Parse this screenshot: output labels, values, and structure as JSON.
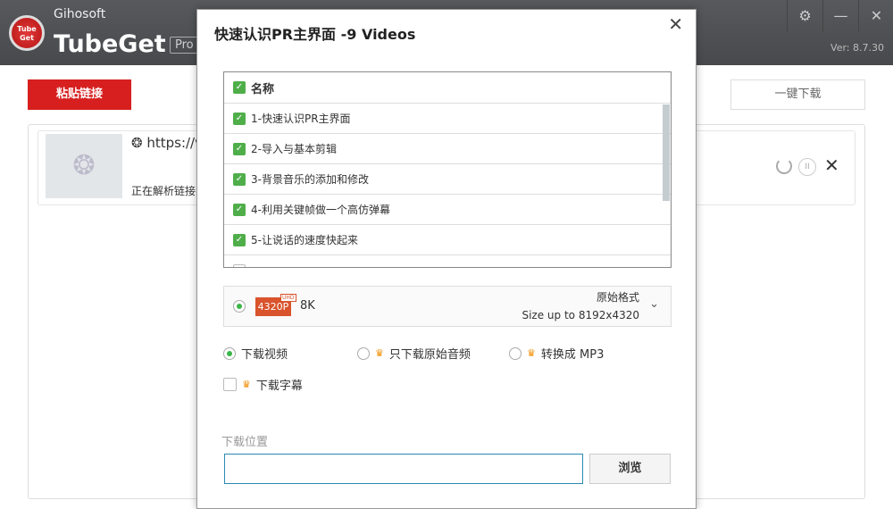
{
  "app": {
    "vendor": "Gihosoft",
    "name": "TubeGet",
    "edition": "Pro",
    "version": "Ver: 8.7.30",
    "logo_text": "Tube Get"
  },
  "toolbar": {
    "paste_label": "粘贴链接",
    "one_click_label": "一键下载"
  },
  "item": {
    "url": "https://v",
    "status": "正在解析链接"
  },
  "dialog": {
    "title": "快速认识PR主界面 -9 Videos",
    "header": "名称",
    "videos": [
      {
        "label": "1-快速认识PR主界面",
        "checked": true
      },
      {
        "label": "2-导入与基本剪辑",
        "checked": true
      },
      {
        "label": "3-背景音乐的添加和修改",
        "checked": true
      },
      {
        "label": "4-利用关键帧做一个高仿弹幕",
        "checked": true
      },
      {
        "label": "5-让说话的速度快起来",
        "checked": true
      }
    ],
    "format": {
      "badge": "4320P",
      "tag": "UHD",
      "quality": "8K",
      "type": "原始格式",
      "size": "Size up to 8192x4320"
    },
    "options": {
      "video": "下载视频",
      "audio": "只下载原始音频",
      "mp3": "转换成 MP3",
      "subs": "下载字幕"
    },
    "location_label": "下载位置",
    "browse_label": "浏览"
  }
}
